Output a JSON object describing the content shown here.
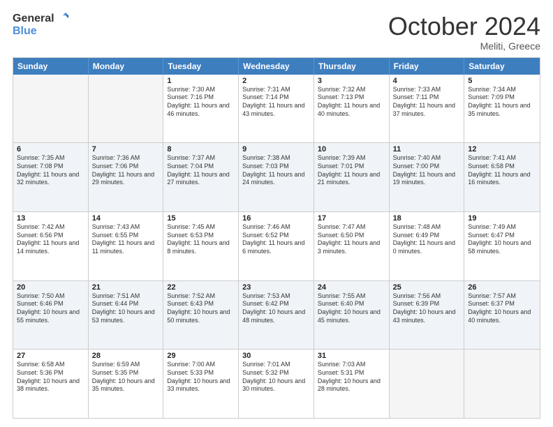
{
  "header": {
    "logo_line1": "General",
    "logo_line2": "Blue",
    "month_title": "October 2024",
    "location": "Meliti, Greece"
  },
  "days_of_week": [
    "Sunday",
    "Monday",
    "Tuesday",
    "Wednesday",
    "Thursday",
    "Friday",
    "Saturday"
  ],
  "weeks": [
    [
      {
        "day": "",
        "sunrise": "",
        "sunset": "",
        "daylight": "",
        "empty": true
      },
      {
        "day": "",
        "sunrise": "",
        "sunset": "",
        "daylight": "",
        "empty": true
      },
      {
        "day": "1",
        "sunrise": "Sunrise: 7:30 AM",
        "sunset": "Sunset: 7:16 PM",
        "daylight": "Daylight: 11 hours and 46 minutes.",
        "empty": false
      },
      {
        "day": "2",
        "sunrise": "Sunrise: 7:31 AM",
        "sunset": "Sunset: 7:14 PM",
        "daylight": "Daylight: 11 hours and 43 minutes.",
        "empty": false
      },
      {
        "day": "3",
        "sunrise": "Sunrise: 7:32 AM",
        "sunset": "Sunset: 7:13 PM",
        "daylight": "Daylight: 11 hours and 40 minutes.",
        "empty": false
      },
      {
        "day": "4",
        "sunrise": "Sunrise: 7:33 AM",
        "sunset": "Sunset: 7:11 PM",
        "daylight": "Daylight: 11 hours and 37 minutes.",
        "empty": false
      },
      {
        "day": "5",
        "sunrise": "Sunrise: 7:34 AM",
        "sunset": "Sunset: 7:09 PM",
        "daylight": "Daylight: 11 hours and 35 minutes.",
        "empty": false
      }
    ],
    [
      {
        "day": "6",
        "sunrise": "Sunrise: 7:35 AM",
        "sunset": "Sunset: 7:08 PM",
        "daylight": "Daylight: 11 hours and 32 minutes.",
        "empty": false
      },
      {
        "day": "7",
        "sunrise": "Sunrise: 7:36 AM",
        "sunset": "Sunset: 7:06 PM",
        "daylight": "Daylight: 11 hours and 29 minutes.",
        "empty": false
      },
      {
        "day": "8",
        "sunrise": "Sunrise: 7:37 AM",
        "sunset": "Sunset: 7:04 PM",
        "daylight": "Daylight: 11 hours and 27 minutes.",
        "empty": false
      },
      {
        "day": "9",
        "sunrise": "Sunrise: 7:38 AM",
        "sunset": "Sunset: 7:03 PM",
        "daylight": "Daylight: 11 hours and 24 minutes.",
        "empty": false
      },
      {
        "day": "10",
        "sunrise": "Sunrise: 7:39 AM",
        "sunset": "Sunset: 7:01 PM",
        "daylight": "Daylight: 11 hours and 21 minutes.",
        "empty": false
      },
      {
        "day": "11",
        "sunrise": "Sunrise: 7:40 AM",
        "sunset": "Sunset: 7:00 PM",
        "daylight": "Daylight: 11 hours and 19 minutes.",
        "empty": false
      },
      {
        "day": "12",
        "sunrise": "Sunrise: 7:41 AM",
        "sunset": "Sunset: 6:58 PM",
        "daylight": "Daylight: 11 hours and 16 minutes.",
        "empty": false
      }
    ],
    [
      {
        "day": "13",
        "sunrise": "Sunrise: 7:42 AM",
        "sunset": "Sunset: 6:56 PM",
        "daylight": "Daylight: 11 hours and 14 minutes.",
        "empty": false
      },
      {
        "day": "14",
        "sunrise": "Sunrise: 7:43 AM",
        "sunset": "Sunset: 6:55 PM",
        "daylight": "Daylight: 11 hours and 11 minutes.",
        "empty": false
      },
      {
        "day": "15",
        "sunrise": "Sunrise: 7:45 AM",
        "sunset": "Sunset: 6:53 PM",
        "daylight": "Daylight: 11 hours and 8 minutes.",
        "empty": false
      },
      {
        "day": "16",
        "sunrise": "Sunrise: 7:46 AM",
        "sunset": "Sunset: 6:52 PM",
        "daylight": "Daylight: 11 hours and 6 minutes.",
        "empty": false
      },
      {
        "day": "17",
        "sunrise": "Sunrise: 7:47 AM",
        "sunset": "Sunset: 6:50 PM",
        "daylight": "Daylight: 11 hours and 3 minutes.",
        "empty": false
      },
      {
        "day": "18",
        "sunrise": "Sunrise: 7:48 AM",
        "sunset": "Sunset: 6:49 PM",
        "daylight": "Daylight: 11 hours and 0 minutes.",
        "empty": false
      },
      {
        "day": "19",
        "sunrise": "Sunrise: 7:49 AM",
        "sunset": "Sunset: 6:47 PM",
        "daylight": "Daylight: 10 hours and 58 minutes.",
        "empty": false
      }
    ],
    [
      {
        "day": "20",
        "sunrise": "Sunrise: 7:50 AM",
        "sunset": "Sunset: 6:46 PM",
        "daylight": "Daylight: 10 hours and 55 minutes.",
        "empty": false
      },
      {
        "day": "21",
        "sunrise": "Sunrise: 7:51 AM",
        "sunset": "Sunset: 6:44 PM",
        "daylight": "Daylight: 10 hours and 53 minutes.",
        "empty": false
      },
      {
        "day": "22",
        "sunrise": "Sunrise: 7:52 AM",
        "sunset": "Sunset: 6:43 PM",
        "daylight": "Daylight: 10 hours and 50 minutes.",
        "empty": false
      },
      {
        "day": "23",
        "sunrise": "Sunrise: 7:53 AM",
        "sunset": "Sunset: 6:42 PM",
        "daylight": "Daylight: 10 hours and 48 minutes.",
        "empty": false
      },
      {
        "day": "24",
        "sunrise": "Sunrise: 7:55 AM",
        "sunset": "Sunset: 6:40 PM",
        "daylight": "Daylight: 10 hours and 45 minutes.",
        "empty": false
      },
      {
        "day": "25",
        "sunrise": "Sunrise: 7:56 AM",
        "sunset": "Sunset: 6:39 PM",
        "daylight": "Daylight: 10 hours and 43 minutes.",
        "empty": false
      },
      {
        "day": "26",
        "sunrise": "Sunrise: 7:57 AM",
        "sunset": "Sunset: 6:37 PM",
        "daylight": "Daylight: 10 hours and 40 minutes.",
        "empty": false
      }
    ],
    [
      {
        "day": "27",
        "sunrise": "Sunrise: 6:58 AM",
        "sunset": "Sunset: 5:36 PM",
        "daylight": "Daylight: 10 hours and 38 minutes.",
        "empty": false
      },
      {
        "day": "28",
        "sunrise": "Sunrise: 6:59 AM",
        "sunset": "Sunset: 5:35 PM",
        "daylight": "Daylight: 10 hours and 35 minutes.",
        "empty": false
      },
      {
        "day": "29",
        "sunrise": "Sunrise: 7:00 AM",
        "sunset": "Sunset: 5:33 PM",
        "daylight": "Daylight: 10 hours and 33 minutes.",
        "empty": false
      },
      {
        "day": "30",
        "sunrise": "Sunrise: 7:01 AM",
        "sunset": "Sunset: 5:32 PM",
        "daylight": "Daylight: 10 hours and 30 minutes.",
        "empty": false
      },
      {
        "day": "31",
        "sunrise": "Sunrise: 7:03 AM",
        "sunset": "Sunset: 5:31 PM",
        "daylight": "Daylight: 10 hours and 28 minutes.",
        "empty": false
      },
      {
        "day": "",
        "sunrise": "",
        "sunset": "",
        "daylight": "",
        "empty": true
      },
      {
        "day": "",
        "sunrise": "",
        "sunset": "",
        "daylight": "",
        "empty": true
      }
    ]
  ]
}
